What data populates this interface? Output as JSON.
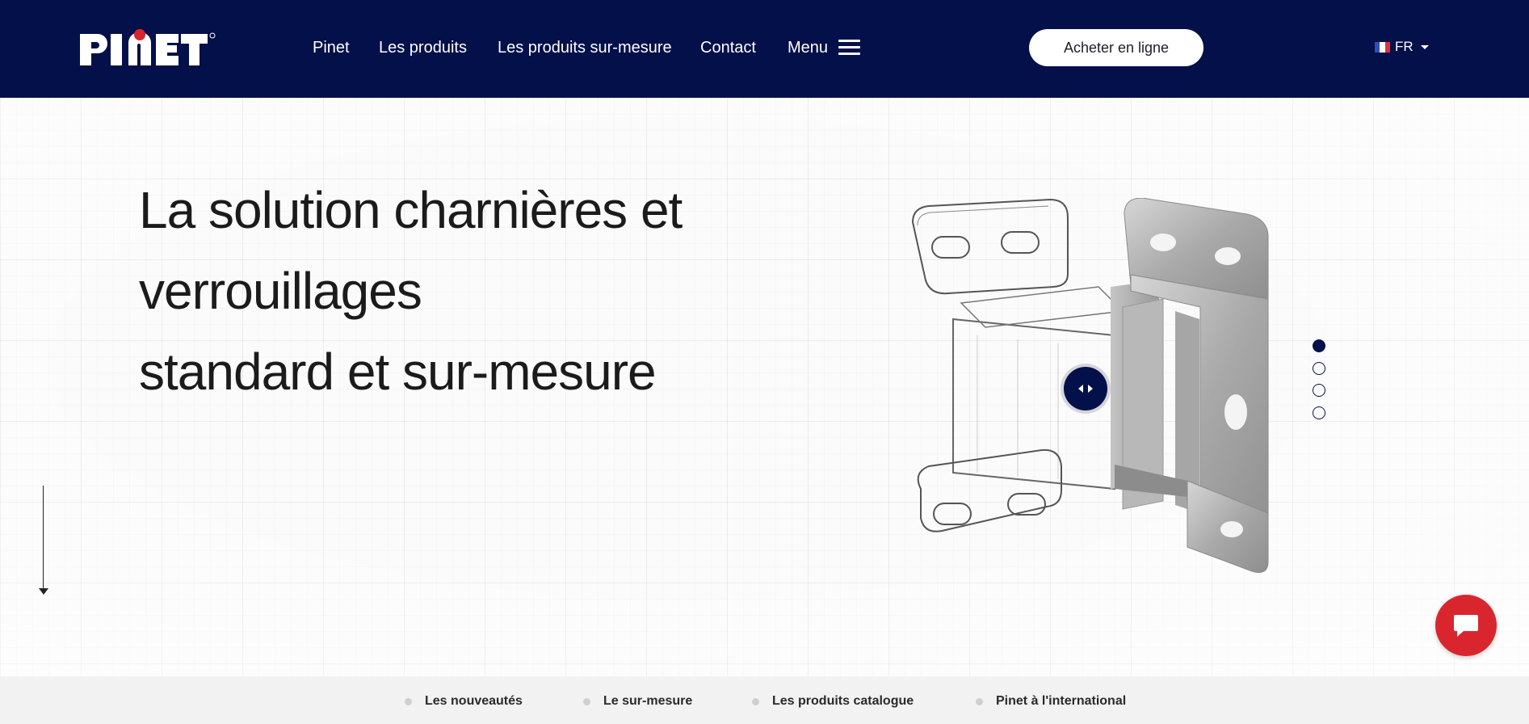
{
  "header": {
    "logo_text": "PINET",
    "nav": [
      {
        "label": "Pinet"
      },
      {
        "label": "Les produits"
      },
      {
        "label": "Les produits sur-mesure"
      },
      {
        "label": "Contact"
      },
      {
        "label": "Menu"
      }
    ],
    "buy_button": "Acheter en ligne",
    "language": "FR",
    "colors": {
      "header_bg": "#03104a",
      "logo_dot": "#d9262e"
    }
  },
  "hero": {
    "title_lines": [
      "La solution charnières et",
      "verrouillages",
      "standard et sur-mesure"
    ],
    "slider_dots": [
      {
        "active": true
      },
      {
        "active": false
      },
      {
        "active": false
      },
      {
        "active": false
      }
    ]
  },
  "bottom_bar": {
    "links": [
      {
        "label": "Les nouveautés"
      },
      {
        "label": "Le sur-mesure"
      },
      {
        "label": "Les produits catalogue"
      },
      {
        "label": "Pinet à l'international"
      }
    ]
  },
  "icons": {
    "menu": "hamburger-icon",
    "chat": "chat-bubble-icon",
    "compare": "left-right-arrows-icon",
    "scroll": "arrow-down-icon",
    "flag": "french-flag-icon"
  },
  "colors": {
    "accent": "#03104a",
    "chat": "#d9262e"
  }
}
